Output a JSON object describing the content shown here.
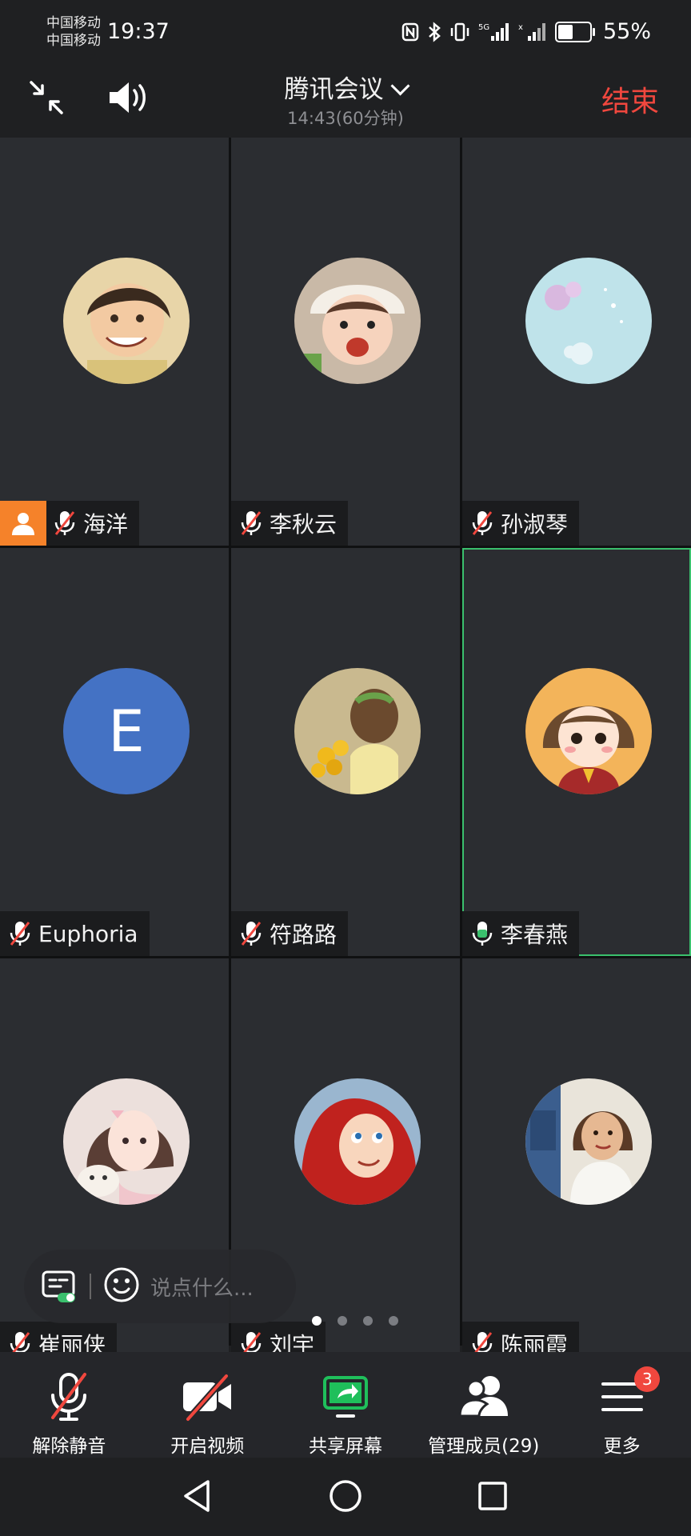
{
  "status_bar": {
    "carrier_1": "中国移动",
    "carrier_2": "中国移动",
    "time": "19:37",
    "battery_percent": "55%",
    "icons": [
      "nfc-icon",
      "bluetooth-icon",
      "vibrate-icon",
      "signal-5g-icon",
      "signal-icon"
    ]
  },
  "header": {
    "title": "腾讯会议",
    "subtitle": "14:43(60分钟)",
    "end_label": "结束"
  },
  "participants": [
    {
      "name": "海洋",
      "mic": "muted",
      "host": true,
      "avatar": "photo-boy"
    },
    {
      "name": "李秋云",
      "mic": "muted",
      "host": false,
      "avatar": "photo-girl"
    },
    {
      "name": "孙淑琴",
      "mic": "muted",
      "host": false,
      "avatar": "photo-bubbles"
    },
    {
      "name": "Euphoria",
      "mic": "muted",
      "host": false,
      "avatar": "letter",
      "letter": "E"
    },
    {
      "name": "符路路",
      "mic": "muted",
      "host": false,
      "avatar": "photo-flowers"
    },
    {
      "name": "李春燕",
      "mic": "active",
      "host": false,
      "avatar": "cartoon-girl",
      "speaking": true
    },
    {
      "name": "崔丽侠",
      "mic": "muted",
      "host": false,
      "avatar": "illustration-cat"
    },
    {
      "name": "刘宇",
      "mic": "muted",
      "host": false,
      "avatar": "cartoon-mermaid"
    },
    {
      "name": "陈丽霞",
      "mic": "muted",
      "host": false,
      "avatar": "photo-woman"
    }
  ],
  "chat": {
    "placeholder": "说点什么..."
  },
  "pager": {
    "pages": 4,
    "current": 1
  },
  "toolbar": {
    "unmute": "解除静音",
    "video": "开启视频",
    "share": "共享屏幕",
    "members": "管理成员(29)",
    "more": "更多",
    "more_badge": "3"
  },
  "colors": {
    "accent_red": "#f0473e",
    "speaking_green": "#3ac06d",
    "host_orange": "#f5822a",
    "share_green": "#1fbf5b"
  }
}
